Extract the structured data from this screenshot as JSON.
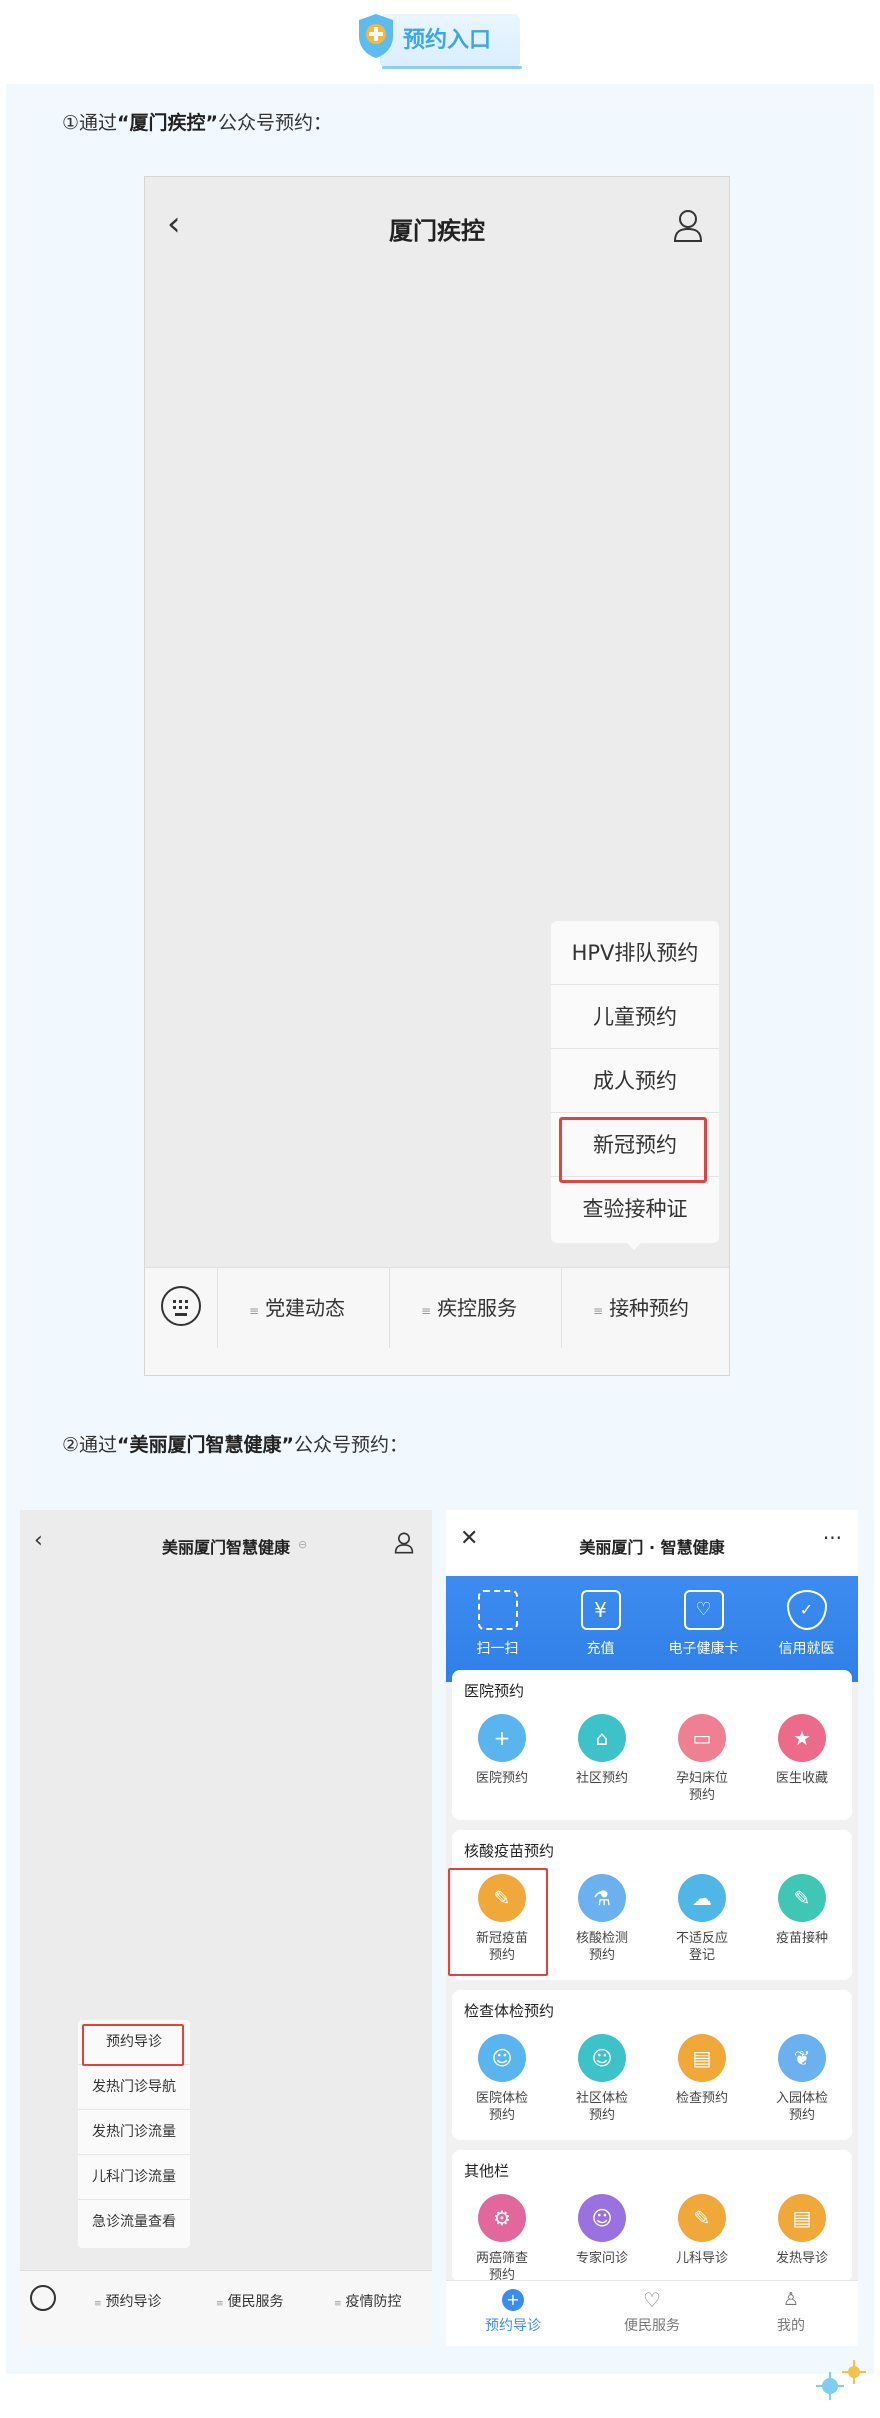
{
  "header": {
    "title": "预约入口"
  },
  "steps": {
    "one": {
      "prefix": "①通过",
      "account": "“厦门疾控”",
      "suffix": "公众号预约："
    },
    "two": {
      "prefix": "②通过",
      "account": "“美丽厦门智慧健康”",
      "suffix": "公众号预约："
    }
  },
  "phone1": {
    "title": "厦门疾控",
    "menu": [
      "HPV排队预约",
      "儿童预约",
      "成人预约",
      "新冠预约",
      "查验接种证"
    ],
    "highlighted": "新冠预约",
    "tabs": [
      "党建动态",
      "疾控服务",
      "接种预约"
    ]
  },
  "phone2": {
    "title": "美丽厦门智慧健康",
    "menu": [
      "预约导诊",
      "发热门诊导航",
      "发热门诊流量",
      "儿科门诊流量",
      "急诊流量查看"
    ],
    "highlighted": "预约导诊",
    "tabs": [
      "预约导诊",
      "便民服务",
      "疫情防控"
    ]
  },
  "phone3": {
    "title": "美丽厦门 · 智慧健康",
    "quick": [
      "扫一扫",
      "充值",
      "电子健康卡",
      "信用就医"
    ],
    "sections": [
      {
        "title": "医院预约",
        "items": [
          [
            "医院预约",
            ""
          ],
          [
            "社区预约",
            ""
          ],
          [
            "孕妇床位",
            "预约"
          ],
          [
            "医生收藏",
            ""
          ]
        ]
      },
      {
        "title": "核酸疫苗预约",
        "items": [
          [
            "新冠疫苗",
            "预约"
          ],
          [
            "核酸检测",
            "预约"
          ],
          [
            "不适反应",
            "登记"
          ],
          [
            "疫苗接种",
            ""
          ]
        ]
      },
      {
        "title": "检查体检预约",
        "items": [
          [
            "医院体检",
            "预约"
          ],
          [
            "社区体检",
            "预约"
          ],
          [
            "检查预约",
            ""
          ],
          [
            "入园体检",
            "预约"
          ]
        ]
      },
      {
        "title": "其他栏",
        "items": [
          [
            "两癌筛查",
            "预约"
          ],
          [
            "专家问诊",
            ""
          ],
          [
            "儿科导诊",
            ""
          ],
          [
            "发热导诊",
            ""
          ]
        ]
      }
    ],
    "nav": [
      "预约导诊",
      "便民服务",
      "我的"
    ]
  },
  "colors": {
    "accent": "#3aa8e6",
    "highlight": "#e2443c",
    "blue": "#3c8cf0"
  }
}
